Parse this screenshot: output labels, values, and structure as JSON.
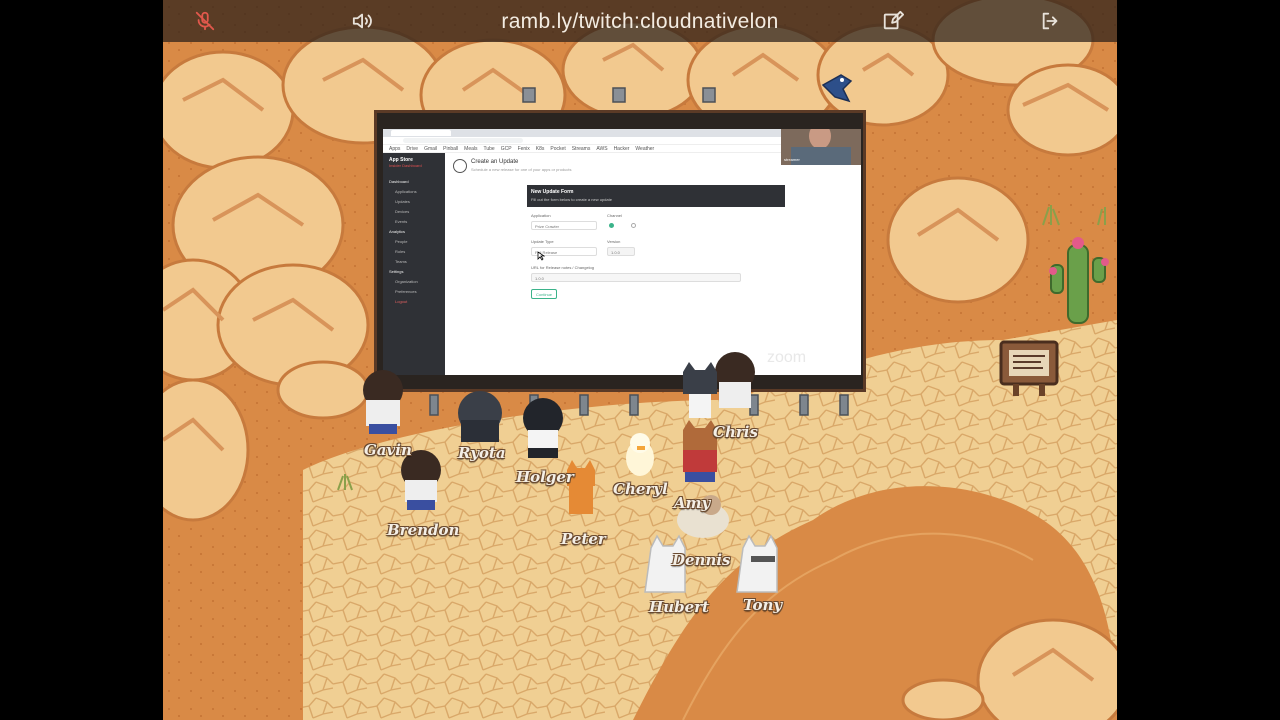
{
  "topbar": {
    "url": "ramb.ly/twitch:cloudnativelon",
    "mic_icon": "mic-muted-icon",
    "speaker_icon": "speaker-icon",
    "edit_icon": "edit-icon",
    "exit_icon": "exit-icon",
    "mic_color": "#e2584c",
    "icon_color": "#e8e2da"
  },
  "share": {
    "bookmarks": [
      "Apps",
      "Drive",
      "Gmail",
      "Pinball",
      "Meals",
      "Tube",
      "GCP",
      "Fenix",
      "K8s",
      "Pocket",
      "Streams",
      "AWS",
      "Hacker",
      "Weather"
    ],
    "app_title": "App Store",
    "app_subtitle": "Insider Dashboard",
    "page_title": "Create an Update",
    "page_subtitle": "Schedule a new release for one of your apps or products",
    "form_header": "New Update Form",
    "form_sub": "Fill out the form below to create a new update",
    "sidebar": [
      "Dashboard",
      "Applications",
      "Updates",
      "Devices",
      "Events",
      "Analytics",
      "People",
      "Roles",
      "Teams",
      "Settings",
      "Organization",
      "Preferences",
      "Logout"
    ],
    "fields": {
      "application_label": "Application",
      "application_value": "Prize Crawler",
      "channel_label": "Channel",
      "update_type_label": "Update Type",
      "update_type_value": "Full Release",
      "version_label": "Version",
      "version_value": "1.0.0",
      "url_label": "URL for Release notes / Changelog",
      "url_value": "1.0.0",
      "submit": "Continue"
    },
    "watermark": "zoom",
    "cam_label": "streamer"
  },
  "players": [
    {
      "name": "Gavin"
    },
    {
      "name": "Ryota"
    },
    {
      "name": "Holger"
    },
    {
      "name": "Cheryl"
    },
    {
      "name": "Chris"
    },
    {
      "name": "Brendon"
    },
    {
      "name": "Peter"
    },
    {
      "name": "Amy"
    },
    {
      "name": "Dennis"
    },
    {
      "name": "Hubert"
    },
    {
      "name": "Tony"
    }
  ],
  "colors": {
    "sand": "#d98a46",
    "path": "#f0cf93",
    "boulder": "#f2c98f",
    "boulder_shade": "#d8945a",
    "cactus": "#6aa04a"
  }
}
